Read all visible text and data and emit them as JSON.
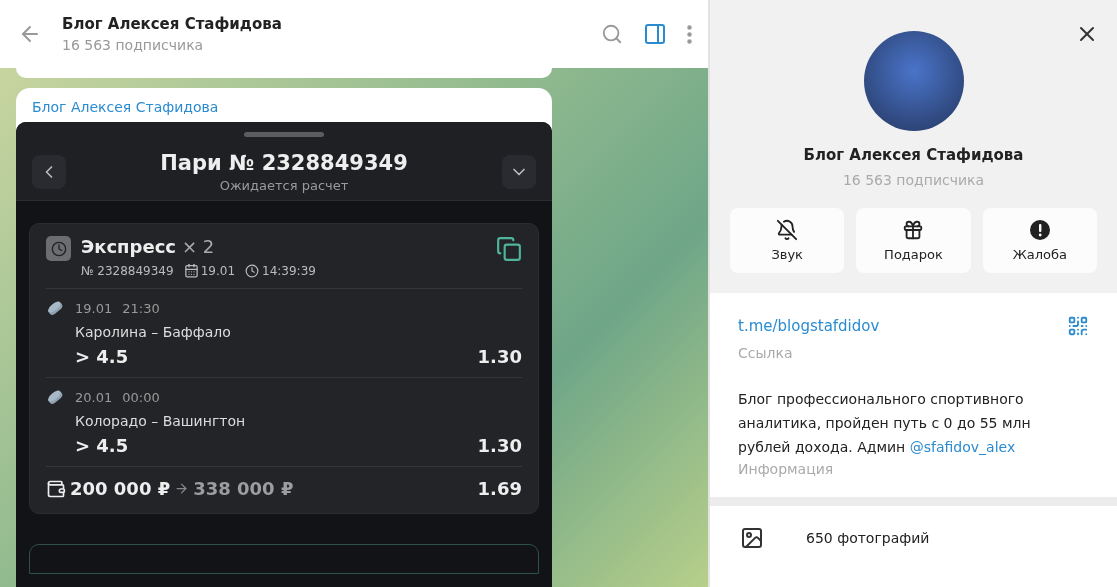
{
  "header": {
    "title": "Блог Алексея Стафидова",
    "subtitle": "16 563 подписчика"
  },
  "message": {
    "sender": "Блог Алексея Стафидова",
    "bet_screenshot": {
      "title": "Пари № 2328849349",
      "status": "Ожидается расчет",
      "bet": {
        "type": "Экспресс",
        "multiplier": "× 2",
        "number": "№ 2328849349",
        "date": "19.01",
        "time": "14:39:39",
        "events": [
          {
            "date": "19.01",
            "time": "21:30",
            "match": "Каролина – Баффало",
            "outcome": "> 4.5",
            "odds": "1.30"
          },
          {
            "date": "20.01",
            "time": "00:00",
            "match": "Колорадо – Вашингтон",
            "outcome": "> 4.5",
            "odds": "1.30"
          }
        ],
        "stake": "200 000 ₽",
        "payout": "338 000 ₽",
        "total_odds": "1.69"
      }
    }
  },
  "profile": {
    "name": "Блог Алексея Стафидова",
    "subscribers": "16 563 подписчика",
    "actions": [
      {
        "kind": "mute",
        "label": "Звук"
      },
      {
        "kind": "gift",
        "label": "Подарок"
      },
      {
        "kind": "report",
        "label": "Жалоба"
      }
    ],
    "link": "t.me/blogstafdidov",
    "link_caption": "Ссылка",
    "about": "Блог профессионального спортивного аналитика, пройден путь с 0 до 55 млн рублей дохода. Админ",
    "mention": "@sfafidov_alex",
    "about_caption": "Информация",
    "media": [
      {
        "kind": "photos",
        "label": "650 фотографий"
      }
    ]
  }
}
